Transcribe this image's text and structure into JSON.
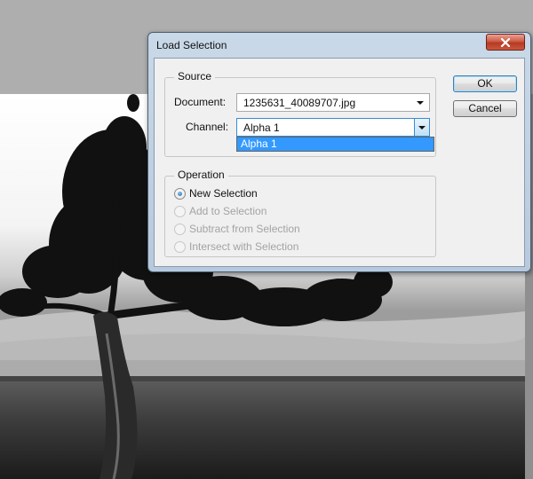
{
  "dialog": {
    "title": "Load Selection",
    "source": {
      "legend": "Source",
      "document_label": "Document:",
      "document_value": "1235631_40089707.jpg",
      "channel_label": "Channel:",
      "channel_value": "Alpha 1",
      "channel_options": [
        "Alpha 1"
      ]
    },
    "operation": {
      "legend": "Operation",
      "options": [
        {
          "label": "New Selection",
          "checked": true,
          "enabled": true
        },
        {
          "label": "Add to Selection",
          "checked": false,
          "enabled": false
        },
        {
          "label": "Subtract from Selection",
          "checked": false,
          "enabled": false
        },
        {
          "label": "Intersect with Selection",
          "checked": false,
          "enabled": false
        }
      ]
    },
    "buttons": {
      "ok": "OK",
      "cancel": "Cancel"
    }
  },
  "icons": {
    "close": "close-icon",
    "dropdown": "chevron-down-icon",
    "radio": "radio-icon"
  },
  "colors": {
    "selection_highlight": "#3399ff",
    "close_button": "#c8432c",
    "window_frame": "#c2d4e6"
  }
}
